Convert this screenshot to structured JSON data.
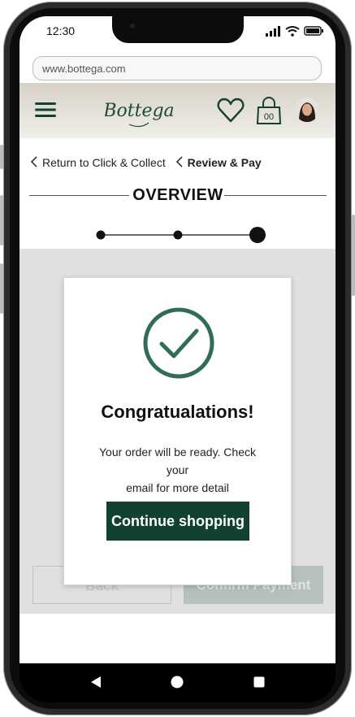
{
  "status": {
    "time": "12:30"
  },
  "browser": {
    "url": "www.bottega.com"
  },
  "header": {
    "logo_text": "Bottega",
    "bag_count": "00"
  },
  "breadcrumb": {
    "back_label": "Return to Click & Collect",
    "current_label": "Review & Pay"
  },
  "section": {
    "title": "OVERVIEW"
  },
  "stepper": {
    "total_steps": 3,
    "current_step": 3
  },
  "background_buttons": {
    "back_label": "Back",
    "confirm_label": "Confirm Payment"
  },
  "modal": {
    "title": "Congratualations!",
    "message_line1": "Your order will be ready. Check your",
    "message_line2": "email for more detail",
    "button_label": "Continue shopping"
  },
  "colors": {
    "brand_green": "#12412f",
    "check_green": "#2f6e55",
    "header_bg": "#d6d2c7",
    "overlay": "#e0e0e0"
  },
  "icons": [
    "menu-icon",
    "heart-icon",
    "bag-icon",
    "avatar",
    "check-circle-icon",
    "chevron-left-icon",
    "nav-back-icon",
    "nav-home-icon",
    "nav-recent-icon"
  ]
}
